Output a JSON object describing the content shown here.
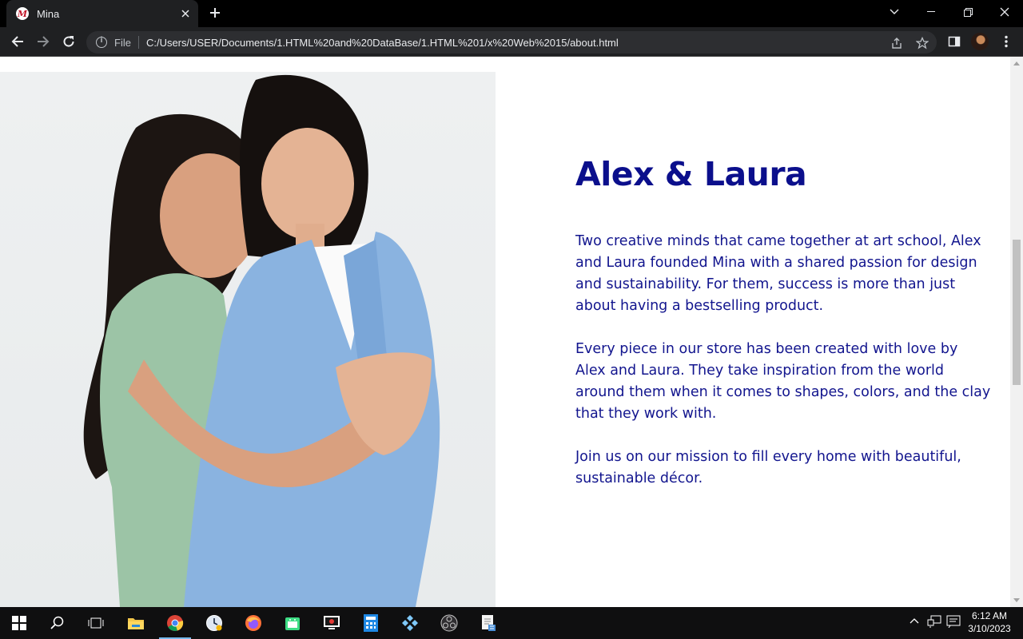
{
  "browser": {
    "tab_title": "Mina",
    "tab_favicon_letter": "M",
    "url_scheme": "File",
    "url": "C:/Users/USER/Documents/1.HTML%20and%20DataBase/1.HTML%201/x%20Web%2015/about.html"
  },
  "page": {
    "heading": "Alex & Laura",
    "paragraphs": [
      "Two creative minds that came together at art school, Alex and Laura founded Mina with a shared passion for design and sustainability. For them, success is more than just about having a bestselling product.",
      "Every piece in our store has been created with love by Alex and Laura. They take inspiration from the world around them when it comes to shapes, colors, and the clay that they work with.",
      "Join us on our mission to fill every home with beautiful, sustainable décor."
    ],
    "photo_icon": "two-women-embracing-photo"
  },
  "taskbar": {
    "apps": [
      "windows-start-icon",
      "search-icon",
      "task-view-icon",
      "file-explorer-icon",
      "chrome-icon",
      "clock-app-icon",
      "firefox-icon",
      "android-studio-icon",
      "media-player-icon",
      "calculator-icon",
      "game-controller-icon",
      "obs-icon",
      "notepad-icon"
    ],
    "time": "6:12 AM",
    "date": "3/10/2023"
  },
  "colors": {
    "heading": "#0b0f8c",
    "text": "#12158e",
    "chrome_bg": "#1f2022"
  }
}
